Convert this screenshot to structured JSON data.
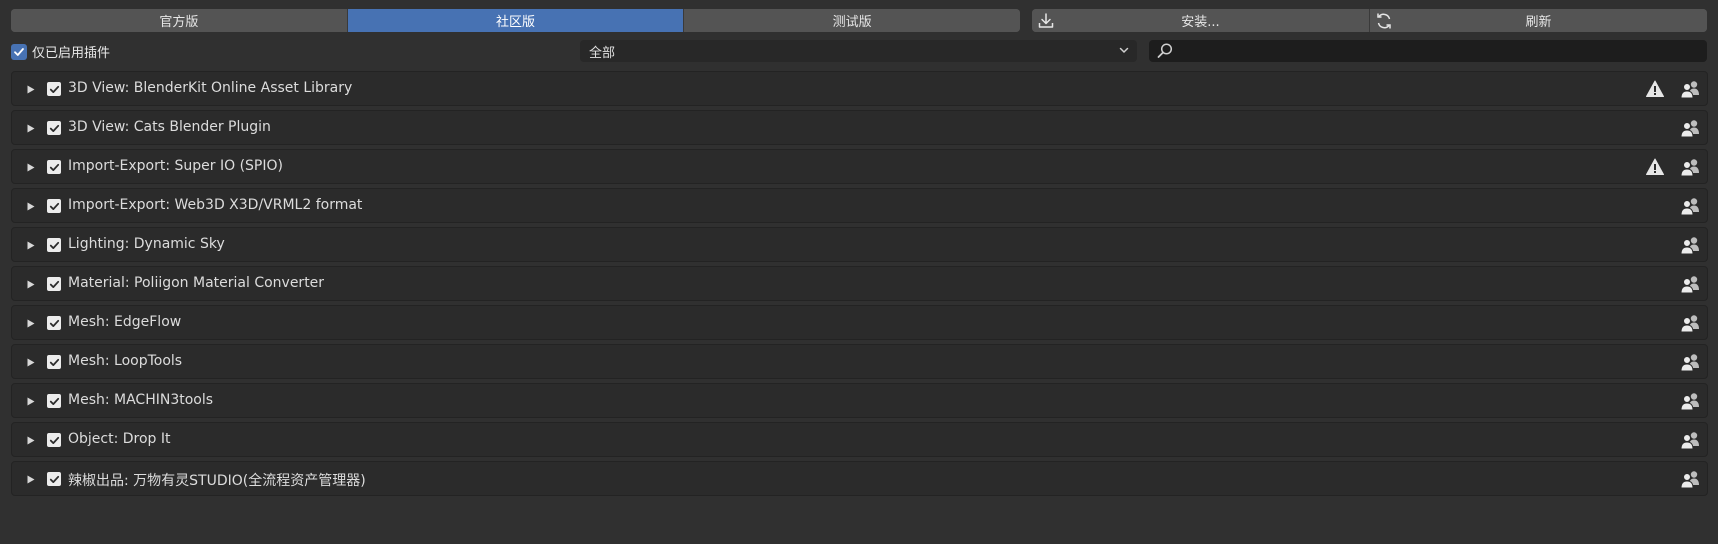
{
  "tabs": [
    {
      "label": "官方版",
      "active": false
    },
    {
      "label": "社区版",
      "active": true
    },
    {
      "label": "测试版",
      "active": false
    }
  ],
  "actions": {
    "install_label": "安装...",
    "install_icon": "download-icon",
    "refresh_label": "刷新",
    "refresh_icon": "refresh-icon"
  },
  "filter": {
    "enabled_only_label": "仅已启用插件",
    "enabled_only_checked": true,
    "category_value": "全部",
    "search_value": ""
  },
  "colors": {
    "accent": "#4772b3",
    "background": "#303030",
    "row_background": "#2b2b2b"
  },
  "addons": [
    {
      "name": "3D View: BlenderKit Online Asset Library",
      "enabled": true,
      "warning": true
    },
    {
      "name": "3D View: Cats Blender Plugin",
      "enabled": true,
      "warning": false
    },
    {
      "name": "Import-Export: Super IO (SPIO)",
      "enabled": true,
      "warning": true
    },
    {
      "name": "Import-Export: Web3D X3D/VRML2 format",
      "enabled": true,
      "warning": false
    },
    {
      "name": "Lighting: Dynamic Sky",
      "enabled": true,
      "warning": false
    },
    {
      "name": "Material: Poliigon Material Converter",
      "enabled": true,
      "warning": false
    },
    {
      "name": "Mesh: EdgeFlow",
      "enabled": true,
      "warning": false
    },
    {
      "name": "Mesh: LoopTools",
      "enabled": true,
      "warning": false
    },
    {
      "name": "Mesh: MACHIN3tools",
      "enabled": true,
      "warning": false
    },
    {
      "name": "Object: Drop It",
      "enabled": true,
      "warning": false
    },
    {
      "name": "辣椒出品: 万物有灵STUDIO(全流程资产管理器)",
      "enabled": true,
      "warning": false
    }
  ]
}
